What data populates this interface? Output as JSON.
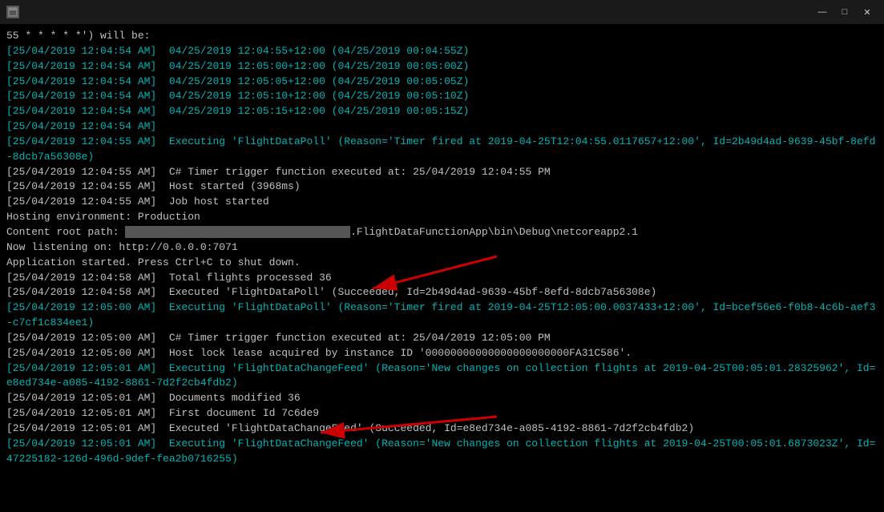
{
  "window": {
    "title": "",
    "controls": {
      "minimize": "—",
      "maximize": "□",
      "close": "✕"
    }
  },
  "terminal": {
    "lines": [
      {
        "text": "55 * * * * *') will be:",
        "color": "white"
      },
      {
        "text": "[25/04/2019 12:04:54 AM]  04/25/2019 12:04:55+12:00 (04/25/2019 00:04:55Z)",
        "color": "cyan"
      },
      {
        "text": "[25/04/2019 12:04:54 AM]  04/25/2019 12:05:00+12:00 (04/25/2019 00:05:00Z)",
        "color": "cyan"
      },
      {
        "text": "[25/04/2019 12:04:54 AM]  04/25/2019 12:05:05+12:00 (04/25/2019 00:05:05Z)",
        "color": "cyan"
      },
      {
        "text": "[25/04/2019 12:04:54 AM]  04/25/2019 12:05:10+12:00 (04/25/2019 00:05:10Z)",
        "color": "cyan"
      },
      {
        "text": "[25/04/2019 12:04:54 AM]  04/25/2019 12:05:15+12:00 (04/25/2019 00:05:15Z)",
        "color": "cyan"
      },
      {
        "text": "[25/04/2019 12:04:54 AM]",
        "color": "cyan"
      },
      {
        "text": "[25/04/2019 12:04:55 AM]  Executing 'FlightDataPoll' (Reason='Timer fired at 2019-04-25T12:04:55.0117657+12:00', Id=2b49d4ad-9639-45bf-8efd-8dcb7a56308e)",
        "color": "cyan"
      },
      {
        "text": "[25/04/2019 12:04:55 AM]  C# Timer trigger function executed at: 25/04/2019 12:04:55 PM",
        "color": "white"
      },
      {
        "text": "[25/04/2019 12:04:55 AM]  Host started (3968ms)",
        "color": "white"
      },
      {
        "text": "[25/04/2019 12:04:55 AM]  Job host started",
        "color": "white"
      },
      {
        "text": "Hosting environment: Production",
        "color": "white"
      },
      {
        "text": "Content root path:                                               .FlightDataFunctionApp\\bin\\Debug\\netcoreapp2.1",
        "color": "white",
        "redacted": true
      },
      {
        "text": "",
        "color": "white"
      },
      {
        "text": "Now listening on: http://0.0.0.0:7071",
        "color": "white"
      },
      {
        "text": "Application started. Press Ctrl+C to shut down.",
        "color": "white"
      },
      {
        "text": "[25/04/2019 12:04:58 AM]  Total flights processed 36",
        "color": "white"
      },
      {
        "text": "[25/04/2019 12:04:58 AM]  Executed 'FlightDataPoll' (Succeeded, Id=2b49d4ad-9639-45bf-8efd-8dcb7a56308e)",
        "color": "white"
      },
      {
        "text": "[25/04/2019 12:05:00 AM]  Executing 'FlightDataPoll' (Reason='Timer fired at 2019-04-25T12:05:00.0037433+12:00', Id=bcef56e6-f0b8-4c6b-aef3-c7cf1c834ee1)",
        "color": "cyan"
      },
      {
        "text": "[25/04/2019 12:05:00 AM]  C# Timer trigger function executed at: 25/04/2019 12:05:00 PM",
        "color": "white"
      },
      {
        "text": "[25/04/2019 12:05:00 AM]  Host lock lease acquired by instance ID '00000000000000000000000FA31C586'.",
        "color": "white"
      },
      {
        "text": "[25/04/2019 12:05:01 AM]  Executing 'FlightDataChangeFeed' (Reason='New changes on collection flights at 2019-04-25T00:05:01.28325962', Id=e8ed734e-a085-4192-8861-7d2f2cb4fdb2)",
        "color": "cyan"
      },
      {
        "text": "[25/04/2019 12:05:01 AM]  Documents modified 36",
        "color": "white"
      },
      {
        "text": "[25/04/2019 12:05:01 AM]  First document Id 7c6de9",
        "color": "white"
      },
      {
        "text": "[25/04/2019 12:05:01 AM]  Executed 'FlightDataChangeFeed' (Succeeded, Id=e8ed734e-a085-4192-8861-7d2f2cb4fdb2)",
        "color": "white"
      },
      {
        "text": "[25/04/2019 12:05:01 AM]  Executing 'FlightDataChangeFeed' (Reason='New changes on collection flights at 2019-04-25T00:05:01.6873023Z', Id=47225182-126d-496d-9def-fea2b0716255)",
        "color": "cyan"
      }
    ]
  }
}
